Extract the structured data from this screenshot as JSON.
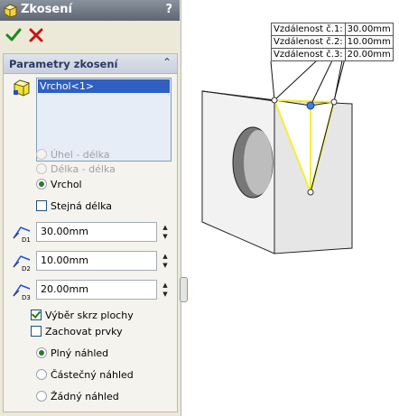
{
  "panel": {
    "title": "Zkosení",
    "help": "?",
    "group_title": "Parametry zkosení",
    "collapse_glyph": "⌃",
    "selection": "Vrchol<1>",
    "modes": [
      {
        "label": "Úhel - délka",
        "enabled": false,
        "selected": false
      },
      {
        "label": "Délka - délka",
        "enabled": false,
        "selected": false
      },
      {
        "label": "Vrchol",
        "enabled": true,
        "selected": true
      }
    ],
    "equal_length": {
      "label": "Stejná délka",
      "checked": false
    },
    "distances": [
      {
        "icon_label": "D1",
        "value": "30.00mm"
      },
      {
        "icon_label": "D2",
        "value": "10.00mm"
      },
      {
        "icon_label": "D3",
        "value": "20.00mm"
      }
    ],
    "select_through_faces": {
      "label": "Výběr skrz plochy",
      "checked": true
    },
    "keep_features": {
      "label": "Zachovat prvky",
      "checked": false
    },
    "previews": [
      {
        "label": "Plný náhled",
        "selected": true
      },
      {
        "label": "Částečný náhled",
        "selected": false
      },
      {
        "label": "Žádný náhled",
        "selected": false
      }
    ]
  },
  "callout": [
    {
      "label": "Vzdálenost č.1:",
      "value": "30.00mm"
    },
    {
      "label": "Vzdálenost č.2:",
      "value": "10.00mm"
    },
    {
      "label": "Vzdálenost č.3:",
      "value": "20.00mm"
    }
  ],
  "colors": {
    "accept": "#1a8a1a",
    "cancel": "#cc1111",
    "selection_highlight": "#2f5fc1",
    "chamfer_preview": "#f5ee3a"
  },
  "icons": [
    "chamfer-icon",
    "checkmark-icon",
    "close-icon",
    "vertex-icon",
    "distance-icon",
    "collapse-icon"
  ]
}
